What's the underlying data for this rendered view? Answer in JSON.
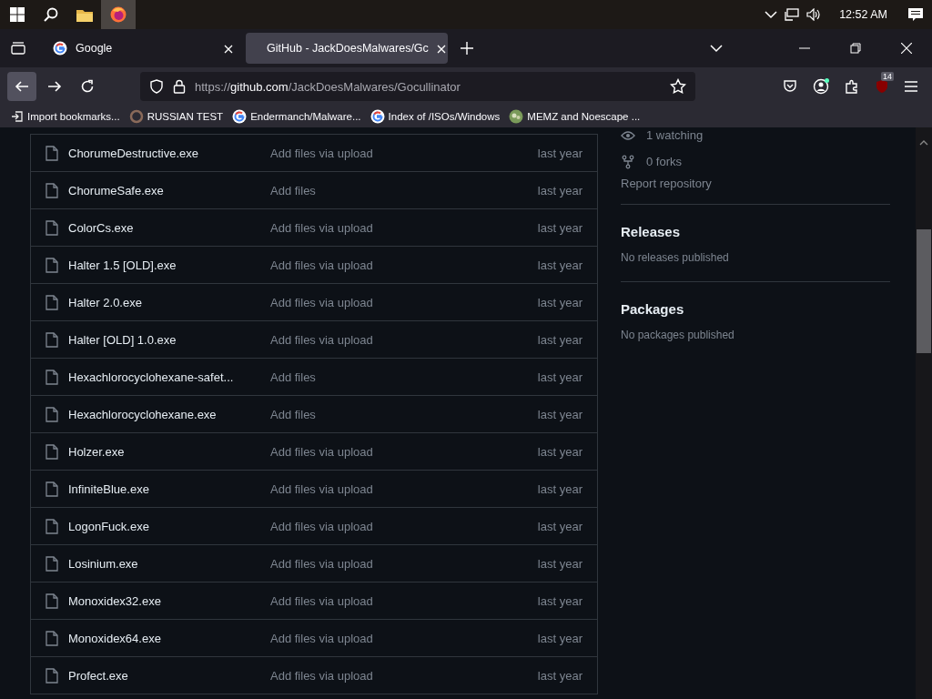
{
  "taskbar": {
    "clock": "12:52 AM"
  },
  "tabs": [
    {
      "title": "Google",
      "kind": "google",
      "selected": false
    },
    {
      "title": "GitHub - JackDoesMalwares/Gc",
      "kind": "github",
      "selected": true
    }
  ],
  "address": {
    "scheme": "https://",
    "domain": "github.com",
    "path": "/JackDoesMalwares/Gocullinator"
  },
  "extension_badge": "14",
  "bookmarks": [
    {
      "label": "Import bookmarks...",
      "kind": "import"
    },
    {
      "label": "RUSSIAN TEST",
      "kind": "ring"
    },
    {
      "label": "Endermanch/Malware...",
      "kind": "google"
    },
    {
      "label": "Index of /ISOs/Windows",
      "kind": "google"
    },
    {
      "label": "MEMZ and Noescape ...",
      "kind": "globe"
    }
  ],
  "files": [
    {
      "name": "ChorumeDestructive.exe",
      "message": "Add files via upload",
      "age": "last year"
    },
    {
      "name": "ChorumeSafe.exe",
      "message": "Add files",
      "age": "last year"
    },
    {
      "name": "ColorCs.exe",
      "message": "Add files via upload",
      "age": "last year"
    },
    {
      "name": "Halter 1.5 [OLD].exe",
      "message": "Add files via upload",
      "age": "last year"
    },
    {
      "name": "Halter 2.0.exe",
      "message": "Add files via upload",
      "age": "last year"
    },
    {
      "name": "Halter [OLD] 1.0.exe",
      "message": "Add files via upload",
      "age": "last year"
    },
    {
      "name": "Hexachlorocyclohexane-safet...",
      "message": "Add files",
      "age": "last year"
    },
    {
      "name": "Hexachlorocyclohexane.exe",
      "message": "Add files",
      "age": "last year"
    },
    {
      "name": "Holzer.exe",
      "message": "Add files via upload",
      "age": "last year"
    },
    {
      "name": "InfiniteBlue.exe",
      "message": "Add files via upload",
      "age": "last year"
    },
    {
      "name": "LogonFuck.exe",
      "message": "Add files via upload",
      "age": "last year"
    },
    {
      "name": "Losinium.exe",
      "message": "Add files via upload",
      "age": "last year"
    },
    {
      "name": "Monoxidex32.exe",
      "message": "Add files via upload",
      "age": "last year"
    },
    {
      "name": "Monoxidex64.exe",
      "message": "Add files via upload",
      "age": "last year"
    },
    {
      "name": "Profect.exe",
      "message": "Add files via upload",
      "age": "last year"
    }
  ],
  "sidebar": {
    "watching": "1 watching",
    "forks": "0 forks",
    "report": "Report repository",
    "sections": [
      {
        "heading": "Releases",
        "note": "No releases published"
      },
      {
        "heading": "Packages",
        "note": "No packages published"
      }
    ]
  }
}
